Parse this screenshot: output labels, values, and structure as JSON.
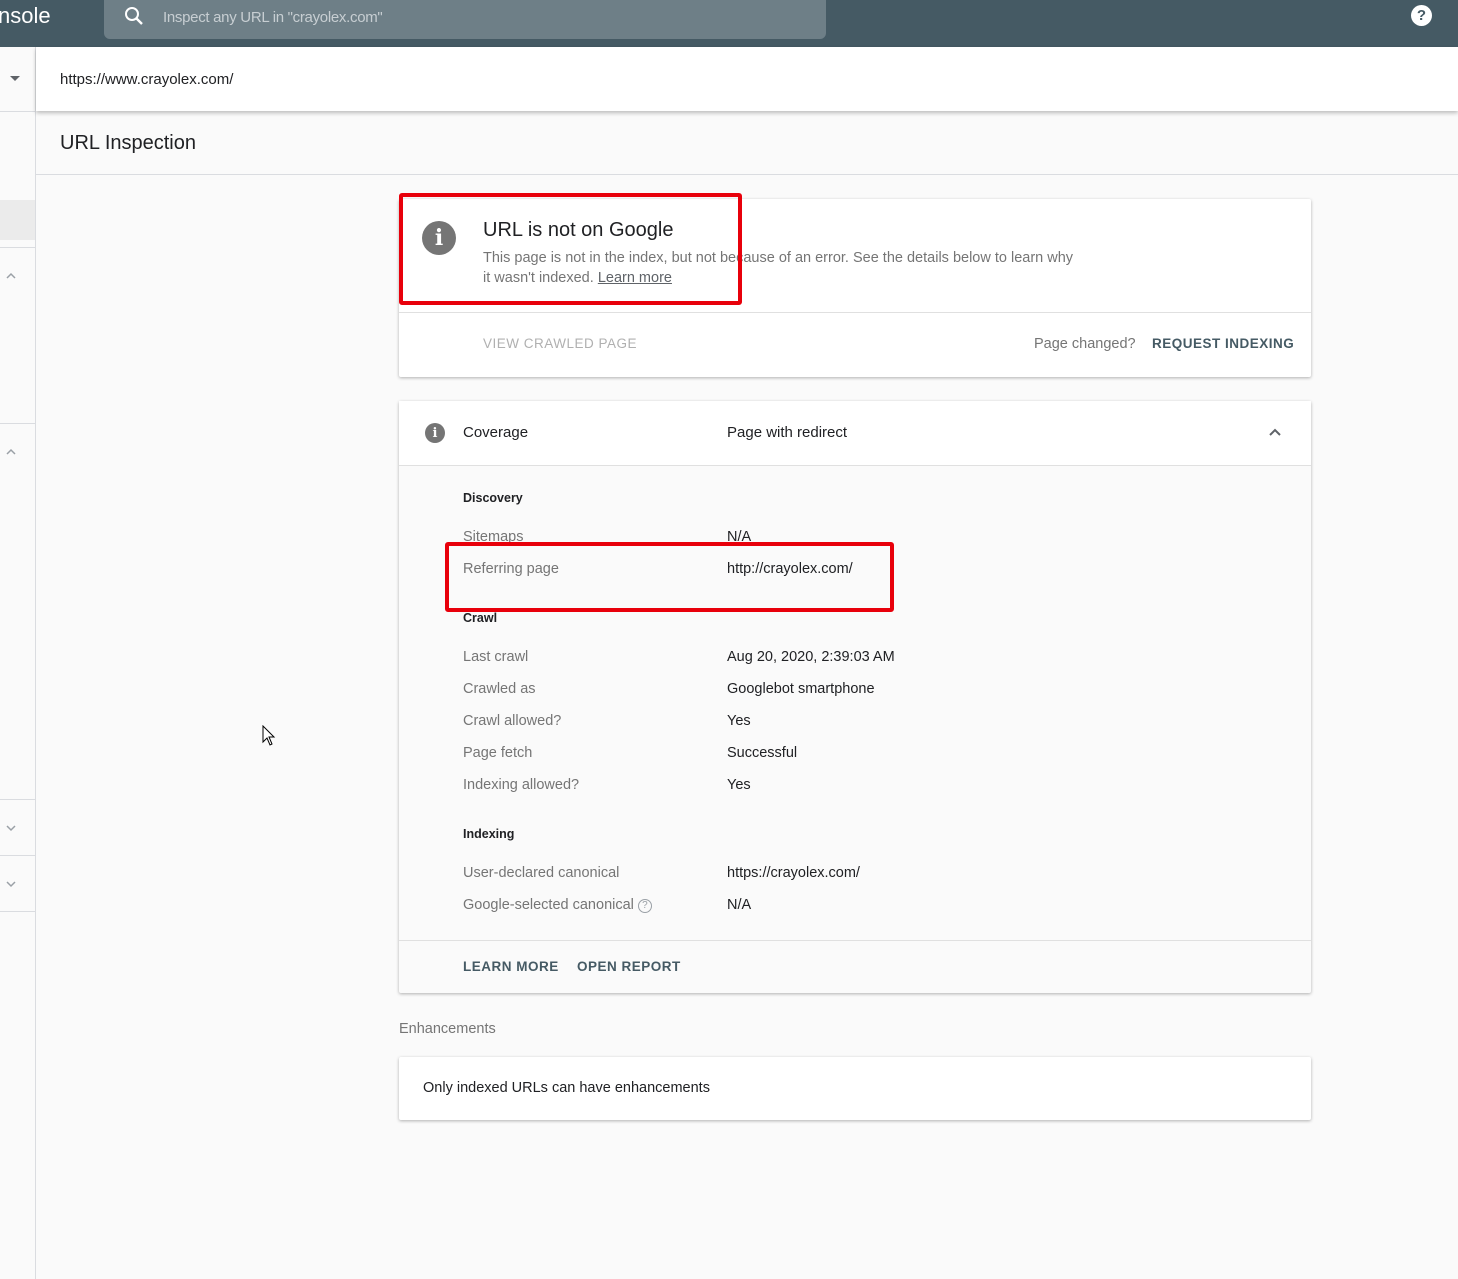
{
  "topbar": {
    "brand": "nsole",
    "search_placeholder": "Inspect any URL in \"crayolex.com\"",
    "search_value": "",
    "help_icon": "?"
  },
  "urlbar": {
    "url": "https://www.crayolex.com/"
  },
  "page": {
    "title": "URL Inspection"
  },
  "status_card": {
    "title": "URL is not on Google",
    "description": "This page is not in the index, but not because of an error. See the details below to learn why it wasn't indexed.",
    "learn_more": "Learn more",
    "view_crawled": "VIEW CRAWLED PAGE",
    "page_changed": "Page changed?",
    "request_indexing": "REQUEST INDEXING"
  },
  "coverage": {
    "label": "Coverage",
    "value": "Page with redirect",
    "sections": {
      "discovery": {
        "title": "Discovery",
        "rows": [
          {
            "label": "Sitemaps",
            "value": "N/A"
          },
          {
            "label": "Referring page",
            "value": "http://crayolex.com/"
          }
        ]
      },
      "crawl": {
        "title": "Crawl",
        "rows": [
          {
            "label": "Last crawl",
            "value": "Aug 20, 2020, 2:39:03 AM"
          },
          {
            "label": "Crawled as",
            "value": "Googlebot smartphone"
          },
          {
            "label": "Crawl allowed?",
            "value": "Yes"
          },
          {
            "label": "Page fetch",
            "value": "Successful"
          },
          {
            "label": "Indexing allowed?",
            "value": "Yes"
          }
        ]
      },
      "indexing": {
        "title": "Indexing",
        "rows": [
          {
            "label": "User-declared canonical",
            "value": "https://crayolex.com/"
          },
          {
            "label": "Google-selected canonical",
            "value": "N/A"
          }
        ]
      }
    },
    "footer": {
      "learn_more": "LEARN MORE",
      "open_report": "OPEN REPORT"
    }
  },
  "enhancements": {
    "label": "Enhancements",
    "message": "Only indexed URLs can have enhancements"
  },
  "colors": {
    "app_bar": "#455a64",
    "annotation": "#e8000b",
    "info_icon": "#757575",
    "action_text": "#455a64"
  }
}
